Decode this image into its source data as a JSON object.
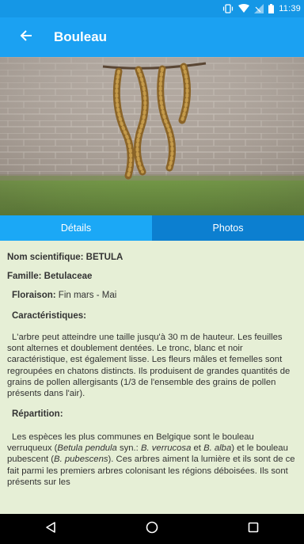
{
  "status_bar": {
    "time": "11:39",
    "icons": [
      "vibrate-icon",
      "wifi-icon",
      "signal-icon",
      "battery-icon"
    ]
  },
  "app_bar": {
    "title": "Bouleau",
    "back_icon": "back-arrow-icon"
  },
  "hero": {
    "alt": "catkins-photo"
  },
  "tabs": [
    {
      "label": "Détails",
      "active": true
    },
    {
      "label": "Photos",
      "active": false
    }
  ],
  "details": {
    "scientific_name": "Nom scientifique: BETULA",
    "family": "Famille: Betulaceae",
    "flowering_label": "Floraison:",
    "flowering_value": " Fin mars - Mai",
    "characteristics_title": "Caractéristiques:",
    "characteristics_text": "L'arbre peut atteindre une taille jusqu'à 30 m de hauteur. Les feuilles sont alternes et doublement dentées. Le tronc, blanc et noir caractéristique, est également lisse. Les fleurs mâles et femelles sont regroupées en chatons distincts. Ils produisent de grandes quantités de grains de pollen allergisants (1/3 de l'ensemble des grains de pollen présents dans l'air).",
    "distribution_title": "Répartition:",
    "distribution_p1": "Les espèces les plus communes en Belgique sont le bouleau verruqueux (",
    "distribution_i1": "Betula pendula",
    "distribution_p2": " syn.: ",
    "distribution_i2": "B. verrucosa",
    "distribution_p3": " et ",
    "distribution_i3": "B. alba",
    "distribution_p4": ") et le bouleau pubescent (",
    "distribution_i4": "B. pubescens",
    "distribution_p5": "). Ces arbres aiment la lumière et ils sont de ce fait parmi les premiers arbres colonisant les régions déboisées. Ils sont présents sur les"
  },
  "nav_bar": {
    "icons": [
      "back-triangle-icon",
      "home-circle-icon",
      "recents-square-icon"
    ]
  },
  "colors": {
    "primary": "#1ba1f2",
    "status": "#1597e6",
    "tab_active": "#1ba8f6",
    "tab_inactive": "#0c7fd0",
    "background": "#e6efd6"
  }
}
